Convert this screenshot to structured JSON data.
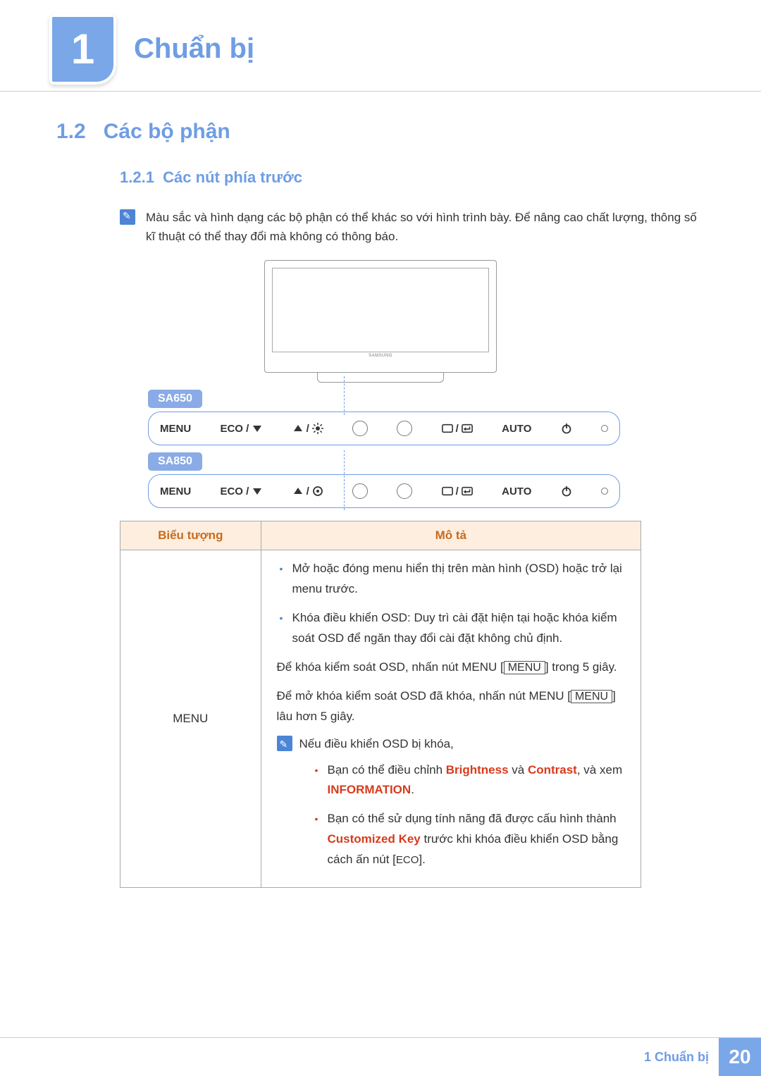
{
  "chapter": {
    "number": "1",
    "title": "Chuẩn bị"
  },
  "section": {
    "number": "1.2",
    "title": "Các bộ phận"
  },
  "subsection": {
    "number": "1.2.1",
    "title": "Các nút phía trước"
  },
  "note": "Màu sắc và hình dạng các bộ phận có thể khác so với hình trình bày. Để nâng cao chất lượng, thông số kĩ thuật có thể thay đổi mà không có thông báo.",
  "illustration": {
    "brand": "SAMSUNG"
  },
  "models": [
    {
      "name": "SA650",
      "buttons": {
        "menu": "MENU",
        "eco": "ECO /",
        "auto": "AUTO",
        "up_variant": "brightness"
      }
    },
    {
      "name": "SA850",
      "buttons": {
        "menu": "MENU",
        "eco": "ECO /",
        "auto": "AUTO",
        "up_variant": "target"
      }
    }
  ],
  "table": {
    "headers": {
      "icon": "Biểu tượng",
      "desc": "Mô tả"
    },
    "row1": {
      "icon_label": "MENU",
      "bullets": [
        "Mở hoặc đóng menu hiển thị trên màn hình (OSD) hoặc trở lại menu trước.",
        "Khóa điều khiển OSD: Duy trì cài đặt hiện tại hoặc khóa kiểm soát OSD để ngăn thay đổi cài đặt không chủ định."
      ],
      "para1_a": "Để khóa kiểm soát OSD, nhấn nút MENU [",
      "para1_b": "MENU",
      "para1_c": "] trong 5 giây.",
      "para2_a": "Để mở khóa kiểm soát OSD đã khóa, nhấn nút MENU [",
      "para2_b": "MENU",
      "para2_c": "] lâu hơn 5 giây.",
      "subnote": "Nếu điều khiển OSD bị khóa,",
      "sub_bullets": [
        {
          "t1": "Bạn có thể điều chỉnh ",
          "hl1": "Brightness",
          "t2": " và ",
          "hl2": "Contrast",
          "t3": ", và xem ",
          "hl3": "INFORMATION",
          "t4": "."
        },
        {
          "t1": "Bạn có thể sử dụng tính năng đã được cấu hình thành ",
          "hl1": "Customized Key",
          "t2": " trước khi khóa điều khiển OSD bằng cách ấn nút [",
          "sc": "ECO",
          "t3": "]."
        }
      ]
    }
  },
  "footer": {
    "label": "1 Chuẩn bị",
    "page": "20"
  }
}
